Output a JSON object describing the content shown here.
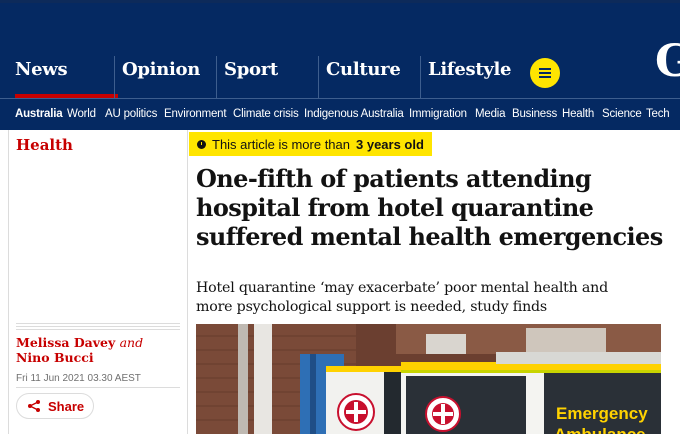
{
  "nav": {
    "pillars": [
      {
        "label": "News",
        "active": true
      },
      {
        "label": "Opinion",
        "active": false
      },
      {
        "label": "Sport",
        "active": false
      },
      {
        "label": "Culture",
        "active": false
      },
      {
        "label": "Lifestyle",
        "active": false
      }
    ],
    "logo_partial": "G"
  },
  "subnav": {
    "items": [
      "Australia",
      "World",
      "AU politics",
      "Environment",
      "Climate crisis",
      "Indigenous Australia",
      "Immigration",
      "Media",
      "Business",
      "Health",
      "Science",
      "Tech"
    ]
  },
  "article": {
    "section": "Health",
    "age_notice_prefix": "This article is more than",
    "age_notice_strong": "3 years old",
    "headline": "One-fifth of patients attending hospital from hotel quarantine suffered mental health emergencies",
    "standfirst": "Hotel quarantine ‘may exacerbate’ poor mental health and more psychological support is needed, study finds",
    "author1": "Melissa Davey",
    "author_join": "and",
    "author2": "Nino Bucci",
    "dateline": "Fri 11 Jun 2021 03.30 AEST",
    "share_label": "Share"
  },
  "photo": {
    "sign_line1": "Emergency",
    "sign_line2": "Ambulance"
  },
  "colors": {
    "brand_navy": "#052962",
    "news_red": "#c70000",
    "highlight_yellow": "#ffe500"
  },
  "icons": [
    "clock-icon",
    "menu-icon",
    "share-icon"
  ]
}
